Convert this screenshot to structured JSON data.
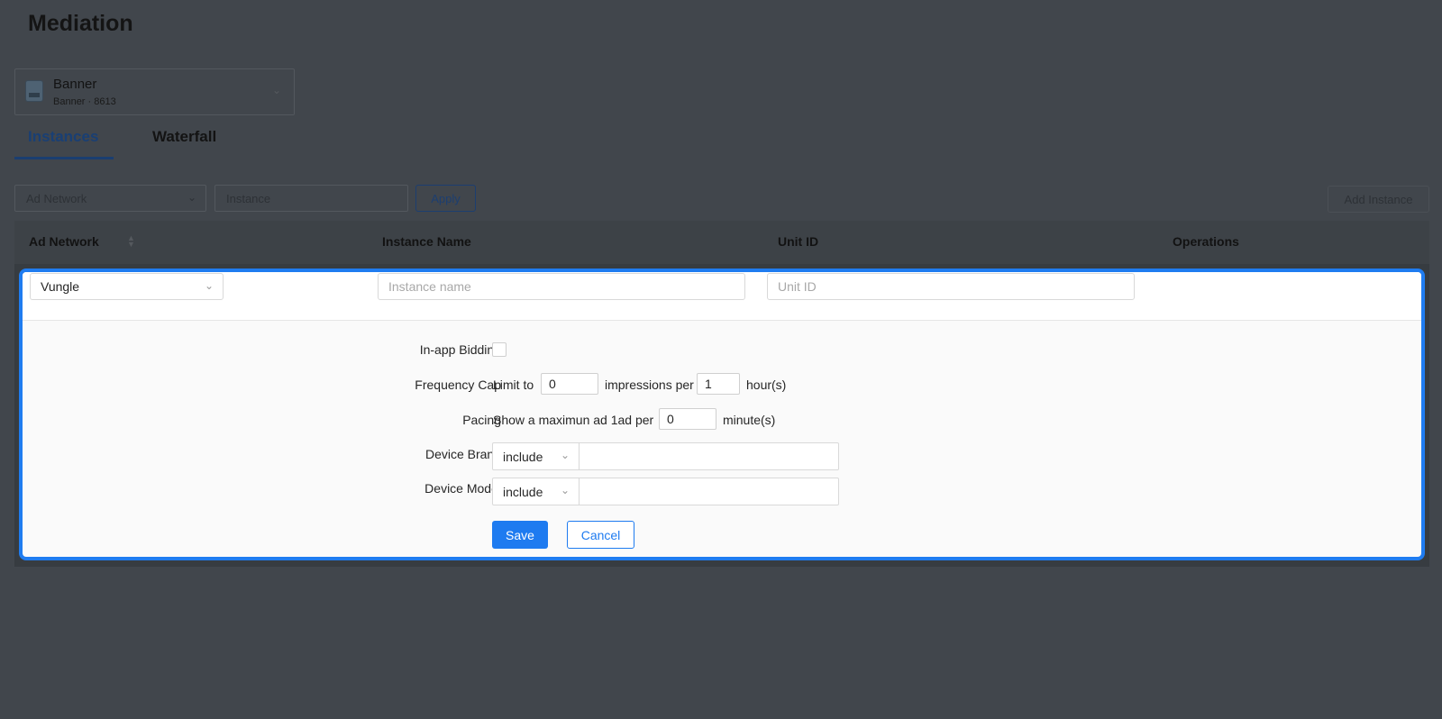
{
  "page": {
    "title": "Mediation"
  },
  "app_select": {
    "name": "Banner",
    "subtitle": "Banner · 8613",
    "icon": "app-icon",
    "chevron": "⌄"
  },
  "tabs": [
    {
      "label": "Instances",
      "active": true
    },
    {
      "label": "Waterfall",
      "active": false
    }
  ],
  "filters": {
    "ad_network_placeholder": "Ad Network",
    "instance_placeholder": "Instance",
    "apply_label": "Apply",
    "add_instance_label": "Add Instance"
  },
  "table": {
    "columns": [
      "Ad Network",
      "Instance Name",
      "Unit ID",
      "Operations"
    ]
  },
  "edit_row": {
    "ad_network_value": "Vungle",
    "instance_name_placeholder": "Instance name",
    "unit_id_placeholder": "Unit ID",
    "in_app_bidding_label": "In-app Bidding",
    "in_app_bidding_checked": false,
    "frequency_cap": {
      "label": "Frequency Cap",
      "limit_to": "Limit to",
      "impressions_value": "0",
      "impressions_per": "impressions per",
      "hours_value": "1",
      "hours_unit": "hour(s)"
    },
    "pacing": {
      "label": "Pacing",
      "prefix": "Show a maximun ad 1ad per",
      "minutes_value": "0",
      "minutes_unit": "minute(s)"
    },
    "device_brand": {
      "label": "Device Brand",
      "mode": "include",
      "value": ""
    },
    "device_model": {
      "label": "Device Model",
      "mode": "include",
      "value": ""
    },
    "save_label": "Save",
    "cancel_label": "Cancel"
  },
  "colors": {
    "overlay_bg": "#41464c",
    "primary": "#1e7bf0",
    "card_bg": "#fafafa"
  }
}
